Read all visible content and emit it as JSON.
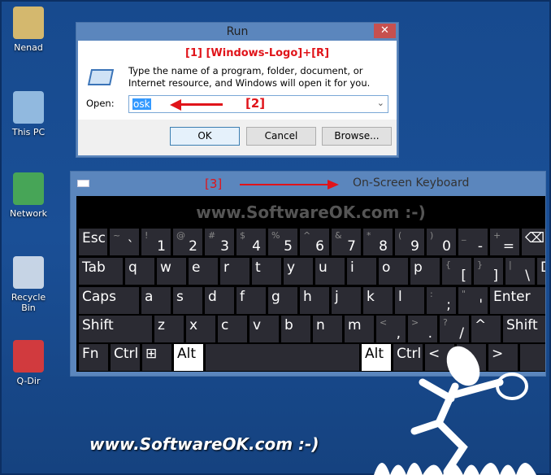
{
  "desktop": {
    "icons": [
      {
        "label": "Nenad",
        "icon": "user-folder-icon"
      },
      {
        "label": "This PC",
        "icon": "computer-icon"
      },
      {
        "label": "Network",
        "icon": "network-icon"
      },
      {
        "label": "Recycle Bin",
        "icon": "recycle-bin-icon"
      },
      {
        "label": "Q-Dir",
        "icon": "q-dir-icon"
      }
    ]
  },
  "run": {
    "title": "Run",
    "close": "✕",
    "annotation1": "[1]  [Windows-Logo]+[R]",
    "description": "Type the name of a program, folder, document, or Internet resource, and Windows will open it for you.",
    "open_label": "Open:",
    "open_value": "osk",
    "annotation2": "[2]",
    "ok": "OK",
    "cancel": "Cancel",
    "browse": "Browse..."
  },
  "osk": {
    "title": "On-Screen Keyboard",
    "annotation3": "[3]",
    "watermark": "www.SoftwareOK.com :-)",
    "rows": [
      [
        {
          "m": "Esc",
          "w": 35
        },
        {
          "s": "~",
          "m": "`"
        },
        {
          "s": "!",
          "m": "1"
        },
        {
          "s": "@",
          "m": "2"
        },
        {
          "s": "#",
          "m": "3"
        },
        {
          "s": "$",
          "m": "4"
        },
        {
          "s": "%",
          "m": "5"
        },
        {
          "s": "^",
          "m": "6"
        },
        {
          "s": "&",
          "m": "7"
        },
        {
          "s": "*",
          "m": "8"
        },
        {
          "s": "(",
          "m": "9"
        },
        {
          "s": ")",
          "m": "0"
        },
        {
          "s": "_",
          "m": "-"
        },
        {
          "s": "+",
          "m": "="
        },
        {
          "m": "⌫",
          "w": 36
        }
      ],
      [
        {
          "m": "Tab",
          "w": 54
        },
        {
          "m": "q"
        },
        {
          "m": "w"
        },
        {
          "m": "e"
        },
        {
          "m": "r"
        },
        {
          "m": "t"
        },
        {
          "m": "y"
        },
        {
          "m": "u"
        },
        {
          "m": "i"
        },
        {
          "m": "o"
        },
        {
          "m": "p"
        },
        {
          "s": "{",
          "m": "["
        },
        {
          "s": "}",
          "m": "]"
        },
        {
          "s": "|",
          "m": "\\"
        },
        {
          "m": "Del"
        }
      ],
      [
        {
          "m": "Caps",
          "w": 74
        },
        {
          "m": "a"
        },
        {
          "m": "s"
        },
        {
          "m": "d"
        },
        {
          "m": "f"
        },
        {
          "m": "g"
        },
        {
          "m": "h"
        },
        {
          "m": "j"
        },
        {
          "m": "k"
        },
        {
          "m": "l"
        },
        {
          "s": ":",
          "m": ";"
        },
        {
          "s": "\"",
          "m": "'"
        },
        {
          "m": "Enter",
          "w": 72
        }
      ],
      [
        {
          "m": "Shift",
          "w": 90
        },
        {
          "m": "z"
        },
        {
          "m": "x"
        },
        {
          "m": "c"
        },
        {
          "m": "v"
        },
        {
          "m": "b"
        },
        {
          "m": "n"
        },
        {
          "m": "m"
        },
        {
          "s": "<",
          "m": ","
        },
        {
          "s": ">",
          "m": "."
        },
        {
          "s": "?",
          "m": "/"
        },
        {
          "m": "^"
        },
        {
          "m": "Shift",
          "w": 60
        }
      ],
      [
        {
          "m": "Fn"
        },
        {
          "m": "Ctrl"
        },
        {
          "m": "⊞"
        },
        {
          "m": "Alt",
          "white": true
        },
        {
          "m": "",
          "w": 189
        },
        {
          "m": "Alt",
          "white": true
        },
        {
          "m": "Ctrl"
        },
        {
          "m": "<"
        },
        {
          "m": "v"
        },
        {
          "m": ">"
        },
        {
          "m": ""
        }
      ]
    ]
  },
  "footer": {
    "watermark": "www.SoftwareOK.com :-)"
  },
  "colors": {
    "desktop": "#1a4f96",
    "titlebar": "#5b86bd",
    "close": "#c7504f",
    "key": "#2b2b33",
    "annotation": "#e0141a"
  }
}
